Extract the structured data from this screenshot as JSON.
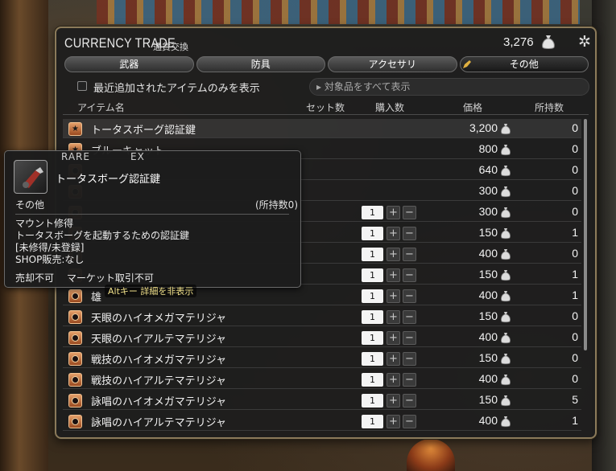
{
  "window": {
    "title": "CURRENCY TRADE",
    "subtitle": "通貨交換",
    "gil_amount": "3,276",
    "gil_icon": "gil-bag-icon",
    "close_icon": "close-x-icon"
  },
  "tabs": [
    {
      "label": "武器",
      "active": false
    },
    {
      "label": "防具",
      "active": false
    },
    {
      "label": "アクセサリ",
      "active": false
    },
    {
      "label": "その他",
      "active": true
    }
  ],
  "filter": {
    "checkbox_label": "最近追加されたアイテムのみを表示",
    "checked": false,
    "dropdown_value": "▸ 対象品をすべて表示"
  },
  "columns": {
    "item": "アイテム名",
    "set": "セット数",
    "buy": "購入数",
    "price": "価格",
    "owned": "所持数"
  },
  "rows": [
    {
      "name": "トータスボーグ認証鍵",
      "icon": "star",
      "qty": null,
      "price": "3,200",
      "owned": "0",
      "selected": true
    },
    {
      "name": "ブルーキャット",
      "icon": "star",
      "qty": null,
      "price": "800",
      "owned": "0"
    },
    {
      "name": "",
      "icon": "orb",
      "qty": null,
      "price": "640",
      "owned": "0"
    },
    {
      "name": "",
      "icon": "orb",
      "qty": null,
      "price": "300",
      "owned": "0"
    },
    {
      "name": "",
      "icon": "orb",
      "qty": "1",
      "price": "300",
      "owned": "0"
    },
    {
      "name": "",
      "icon": "orb",
      "qty": "1",
      "price": "150",
      "owned": "1"
    },
    {
      "name": "",
      "icon": "orb",
      "qty": "1",
      "price": "400",
      "owned": "0"
    },
    {
      "name": "",
      "icon": "orb",
      "qty": "1",
      "price": "150",
      "owned": "1"
    },
    {
      "name": "雄",
      "icon": "orb",
      "qty": "1",
      "price": "400",
      "owned": "1"
    },
    {
      "name": "天眼のハイオメガマテリジャ",
      "icon": "orb",
      "qty": "1",
      "price": "150",
      "owned": "0"
    },
    {
      "name": "天眼のハイアルテマテリジャ",
      "icon": "orb",
      "qty": "1",
      "price": "400",
      "owned": "0"
    },
    {
      "name": "戦技のハイオメガマテリジャ",
      "icon": "orb",
      "qty": "1",
      "price": "150",
      "owned": "0"
    },
    {
      "name": "戦技のハイアルテマテリジャ",
      "icon": "orb",
      "qty": "1",
      "price": "400",
      "owned": "0"
    },
    {
      "name": "詠唱のハイオメガマテリジャ",
      "icon": "orb",
      "qty": "1",
      "price": "150",
      "owned": "5"
    },
    {
      "name": "詠唱のハイアルテマテリジャ",
      "icon": "orb",
      "qty": "1",
      "price": "400",
      "owned": "1"
    }
  ],
  "tooltip": {
    "rare": "RARE",
    "ex": "EX",
    "name": "トータスボーグ認証鍵",
    "category": "その他",
    "owned": "(所持数0)",
    "desc": [
      "マウント修得",
      "トータスボーグを起動するための認証鍵",
      "[未修得/未登録]",
      "SHOP販売:なし"
    ],
    "trade": [
      "売却不可",
      "マーケット取引不可"
    ]
  },
  "alt_hint": "Altキー 詳細を非表示"
}
